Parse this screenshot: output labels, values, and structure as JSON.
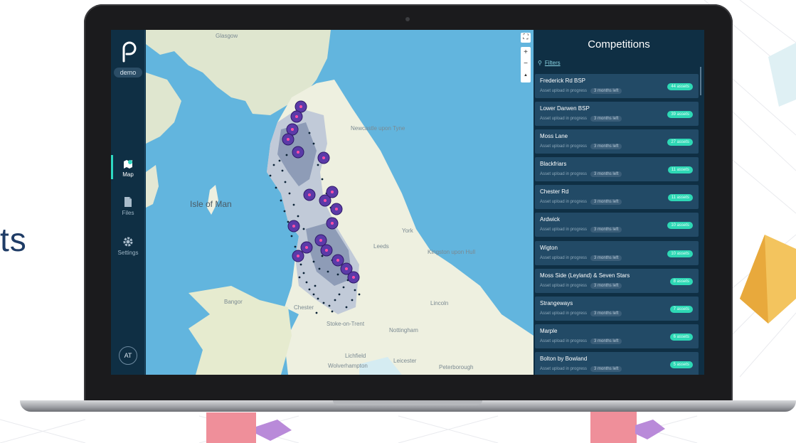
{
  "background": {
    "partial_text": "ts"
  },
  "app": {
    "logo": "p-logo",
    "environment": "demo"
  },
  "sidebar": {
    "items": [
      {
        "label": "Map",
        "icon": "map-pin-icon",
        "active": true
      },
      {
        "label": "Files",
        "icon": "file-icon",
        "active": false
      },
      {
        "label": "Settings",
        "icon": "gear-icon",
        "active": false
      }
    ],
    "user_initials": "AT"
  },
  "map": {
    "labels": {
      "glasgow": "Glasgow",
      "newcastle": "Newcastle upon Tyne",
      "isle_of_man": "Isle of Man",
      "york": "York",
      "leeds": "Leeds",
      "kingston": "Kingston upon Hull",
      "bangor": "Bangor",
      "chester": "Chester",
      "lincoln": "Lincoln",
      "stoke": "Stoke-on-Trent",
      "nottingham": "Nottingham",
      "lichfield": "Lichfield",
      "leicester": "Leicester",
      "wolverhampton": "Wolverhampton",
      "peterborough": "Peterborough"
    },
    "controls": {
      "fullscreen": "⛶",
      "zoom_in": "+",
      "zoom_out": "−",
      "reset_north": "▲"
    }
  },
  "panel": {
    "title": "Competitions",
    "filters_label": "Filters",
    "competitions": [
      {
        "name": "Frederick Rd BSP",
        "status": "Asset upload in progress",
        "time_left": "3 months left",
        "assets": "44 assets"
      },
      {
        "name": "Lower Darwen BSP",
        "status": "Asset upload in progress",
        "time_left": "3 months left",
        "assets": "39 assets"
      },
      {
        "name": "Moss Lane",
        "status": "Asset upload in progress",
        "time_left": "3 months left",
        "assets": "27 assets"
      },
      {
        "name": "Blackfriars",
        "status": "Asset upload in progress",
        "time_left": "3 months left",
        "assets": "11 assets"
      },
      {
        "name": "Chester Rd",
        "status": "Asset upload in progress",
        "time_left": "3 months left",
        "assets": "11 assets"
      },
      {
        "name": "Ardwick",
        "status": "Asset upload in progress",
        "time_left": "3 months left",
        "assets": "10 assets"
      },
      {
        "name": "Wigton",
        "status": "Asset upload in progress",
        "time_left": "3 months left",
        "assets": "10 assets"
      },
      {
        "name": "Moss Side (Leyland) & Seven Stars",
        "status": "Asset upload in progress",
        "time_left": "3 months left",
        "assets": "8 assets"
      },
      {
        "name": "Strangeways",
        "status": "Asset upload in progress",
        "time_left": "3 months left",
        "assets": "7 assets"
      },
      {
        "name": "Marple",
        "status": "Asset upload in progress",
        "time_left": "3 months left",
        "assets": "6 assets"
      },
      {
        "name": "Bolton by Bowland",
        "status": "Asset upload in progress",
        "time_left": "3 months left",
        "assets": "5 assets"
      }
    ]
  },
  "colors": {
    "sidebar_bg": "#0f2f44",
    "card_bg": "#224a66",
    "accent": "#2ed8c3",
    "sea": "#62b5de",
    "land": "#eef0e0",
    "marker": "#5b3aa8"
  }
}
